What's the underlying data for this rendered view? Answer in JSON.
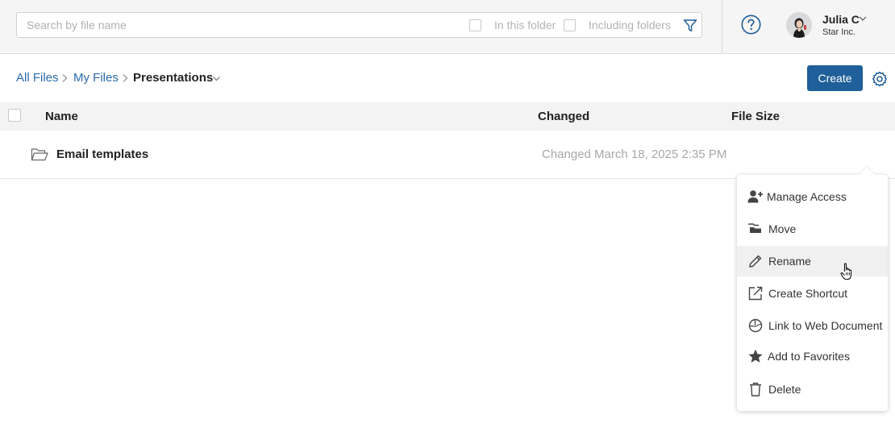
{
  "search": {
    "placeholder": "Search by file name",
    "in_this_folder_label": "In this folder",
    "including_folders_label": "Including folders"
  },
  "user": {
    "name": "Julia C",
    "org": "Star Inc."
  },
  "breadcrumb": {
    "items": [
      "All Files",
      "My Files",
      "Presentations"
    ]
  },
  "toolbar": {
    "create_label": "Create"
  },
  "table": {
    "headers": {
      "name": "Name",
      "changed": "Changed",
      "size": "File Size"
    },
    "rows": [
      {
        "name": "Email templates",
        "changed": "Changed March 18, 2025 2:35 PM",
        "size": ""
      }
    ]
  },
  "context_menu": {
    "items": [
      {
        "label": "Manage Access",
        "icon": "user-plus-icon"
      },
      {
        "label": "Move",
        "icon": "folders-move-icon"
      },
      {
        "label": "Rename",
        "icon": "pencil-icon"
      },
      {
        "label": "Create Shortcut",
        "icon": "external-link-icon"
      },
      {
        "label": "Link to Web Document",
        "icon": "web-document-icon"
      },
      {
        "label": "Add to Favorites",
        "icon": "star-icon"
      },
      {
        "label": "Delete",
        "icon": "trash-icon"
      }
    ]
  },
  "colors": {
    "accent": "#1f5f9a",
    "link": "#2c6aa8",
    "hover": "#f0f0f0"
  }
}
